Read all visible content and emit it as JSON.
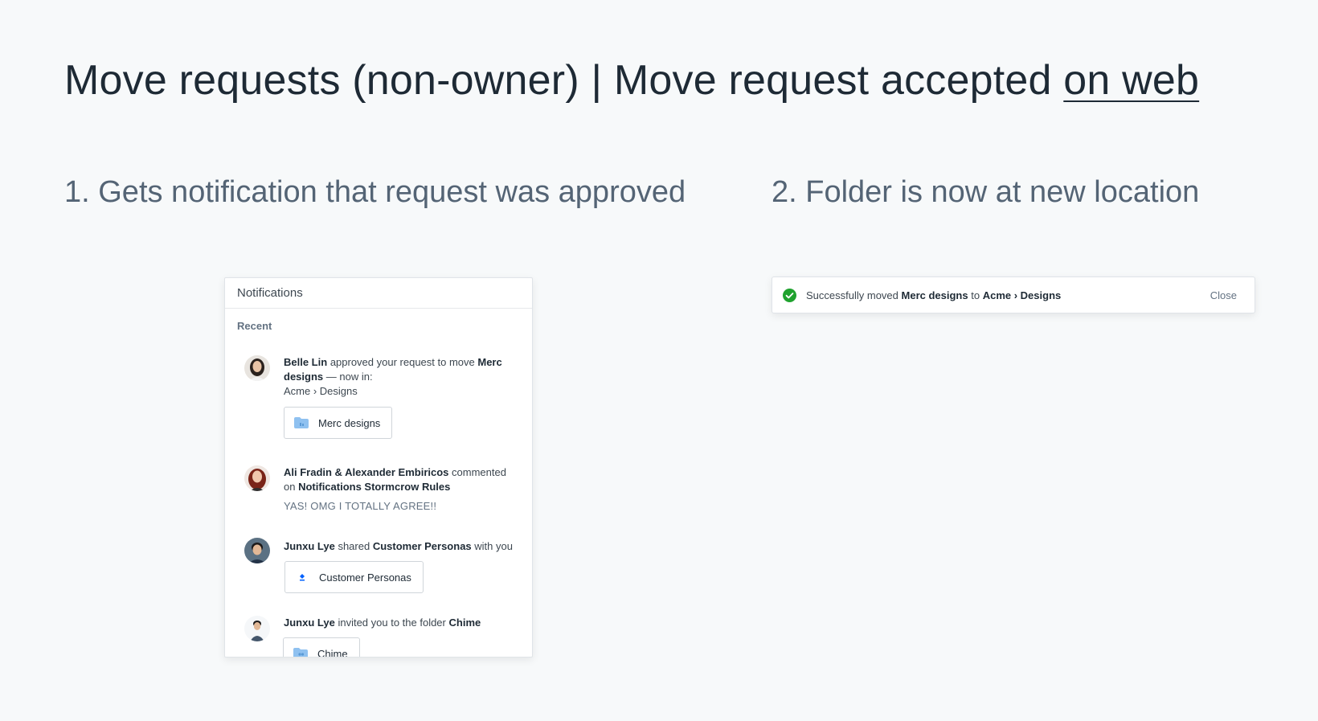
{
  "header": {
    "title_main": "Move requests (non-owner)",
    "separator": "|",
    "title_rest": "Move request accepted",
    "title_link": "on web"
  },
  "steps": [
    {
      "label": "1. Gets notification that request was approved"
    },
    {
      "label": "2. Folder is now at new location"
    }
  ],
  "notifications": {
    "title": "Notifications",
    "section": "Recent",
    "items": [
      {
        "actor": "Belle Lin",
        "verb": "approved your request to move",
        "object": "Merc designs",
        "suffix": "— now in:",
        "location": "Acme › Designs",
        "chip": {
          "label": "Merc designs",
          "icon": "folder-icon"
        }
      },
      {
        "actor": "Ali Fradin & Alexander Embiricos",
        "verb": "commented on",
        "object": "Notifications Stormcrow Rules",
        "quote": "YAS! OMG I TOTALLY AGREE!!"
      },
      {
        "actor": "Junxu Lye",
        "verb": "shared",
        "object": "Customer Personas",
        "suffix": "with you",
        "chip": {
          "label": "Customer Personas",
          "icon": "paper-doc-icon"
        }
      },
      {
        "actor": "Junxu Lye",
        "verb": "invited you to the folder",
        "object": "Chime",
        "chip": {
          "label": "Chime",
          "icon": "shared-folder-icon"
        }
      }
    ]
  },
  "toast": {
    "prefix": "Successfully moved",
    "item": "Merc designs",
    "mid": "to",
    "destination": "Acme › Designs",
    "close_label": "Close",
    "status_color": "#1fa22e",
    "icon": "check-circle-icon"
  },
  "colors": {
    "background": "#f7f9fa",
    "folder_blue": "#8fc1f0",
    "success_green": "#1fa22e"
  }
}
